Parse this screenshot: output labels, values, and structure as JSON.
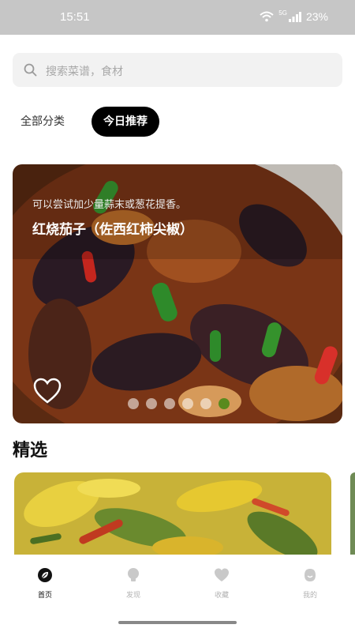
{
  "status_bar": {
    "time": "15:51",
    "signal_label": "5G",
    "battery": "23%"
  },
  "search": {
    "placeholder": "搜索菜谱，食材"
  },
  "tabs": [
    {
      "label": "全部分类",
      "selected": false
    },
    {
      "label": "今日推荐",
      "selected": true
    }
  ],
  "banner": {
    "subtitle": "可以尝试加少量蒜末或葱花提香。",
    "title": "红烧茄子（佐西红柿尖椒）",
    "dot_count": 6,
    "active_dot": 6
  },
  "featured": {
    "title": "精选"
  },
  "bottom_nav": [
    {
      "label": "首页",
      "icon": "leaf-icon",
      "active": true
    },
    {
      "label": "发现",
      "icon": "bulb-icon",
      "active": false
    },
    {
      "label": "收藏",
      "icon": "heart-icon",
      "active": false
    },
    {
      "label": "我的",
      "icon": "profile-icon",
      "active": false
    }
  ],
  "colors": {
    "accent": "#000000",
    "active_dot": "#5a8a1e",
    "status_bar": "#c6c6c6"
  }
}
